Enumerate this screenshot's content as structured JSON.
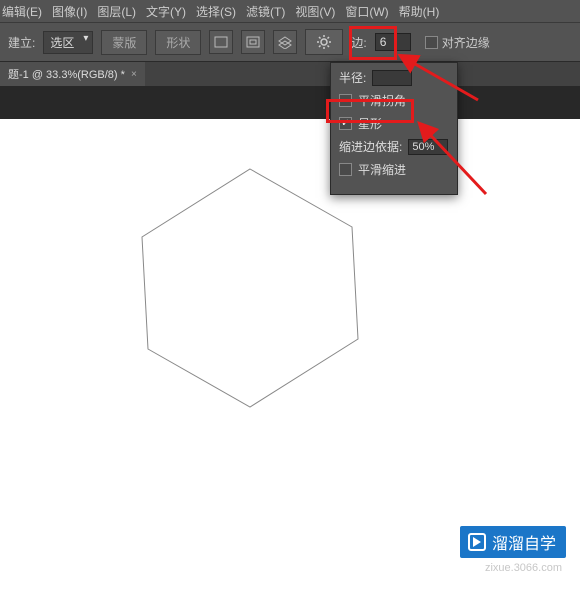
{
  "menubar": [
    "编辑(E)",
    "图像(I)",
    "图层(L)",
    "文字(Y)",
    "选择(S)",
    "滤镜(T)",
    "视图(V)",
    "窗口(W)",
    "帮助(H)"
  ],
  "options": {
    "create_label": "建立:",
    "create_value": "选区",
    "mask": "蒙版",
    "shape": "形状",
    "sides_label": "边:",
    "sides_value": "6",
    "align_edges": "对齐边缘"
  },
  "tab": {
    "title": "题-1 @ 33.3%(RGB/8) *"
  },
  "popup": {
    "radius_label": "半径:",
    "smooth_corners": "平滑拐角",
    "star": "星形",
    "indent_label": "缩进边依据:",
    "indent_value": "50%",
    "smooth_indent": "平滑缩进"
  },
  "watermark": {
    "brand": "溜溜自学",
    "url": "zixue.3066.com"
  }
}
